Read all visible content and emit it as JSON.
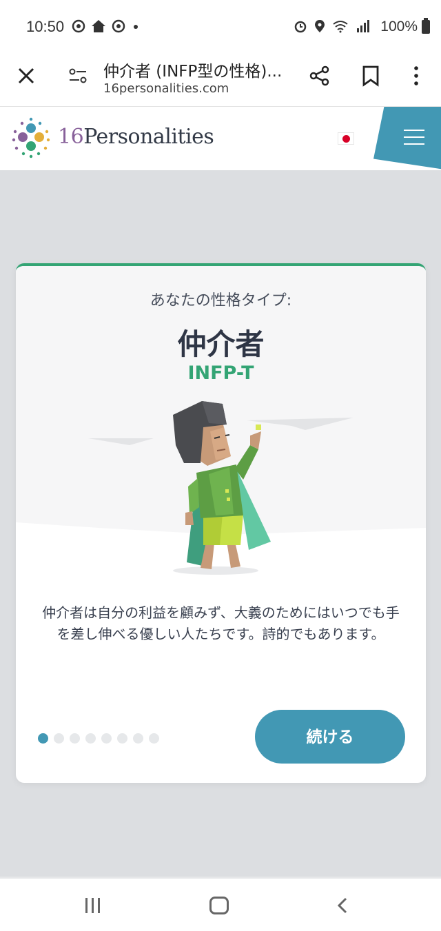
{
  "status_bar": {
    "time": "10:50",
    "battery": "100%",
    "icons": [
      "chrome-icon",
      "home-icon",
      "chrome-icon",
      "dot-icon",
      "alarm-icon",
      "location-icon",
      "wifi-icon",
      "signal-icon",
      "battery-icon"
    ]
  },
  "browser": {
    "page_title": "仲介者 (INFP型の性格)...",
    "url": "16personalities.com"
  },
  "site": {
    "logo_number": "16",
    "logo_name": "Personalities"
  },
  "card": {
    "subtitle": "あなたの性格タイプ:",
    "title": "仲介者",
    "code": "INFP-T",
    "description": "仲介者は自分の利益を顧みず、大義のためにはいつでも手を差し伸べる優しい人たちです。詩的でもあります。",
    "continue_label": "続ける",
    "pagination": {
      "current": 1,
      "total": 8
    },
    "colors": {
      "accent": "#33a474",
      "button": "#4298b4"
    }
  }
}
